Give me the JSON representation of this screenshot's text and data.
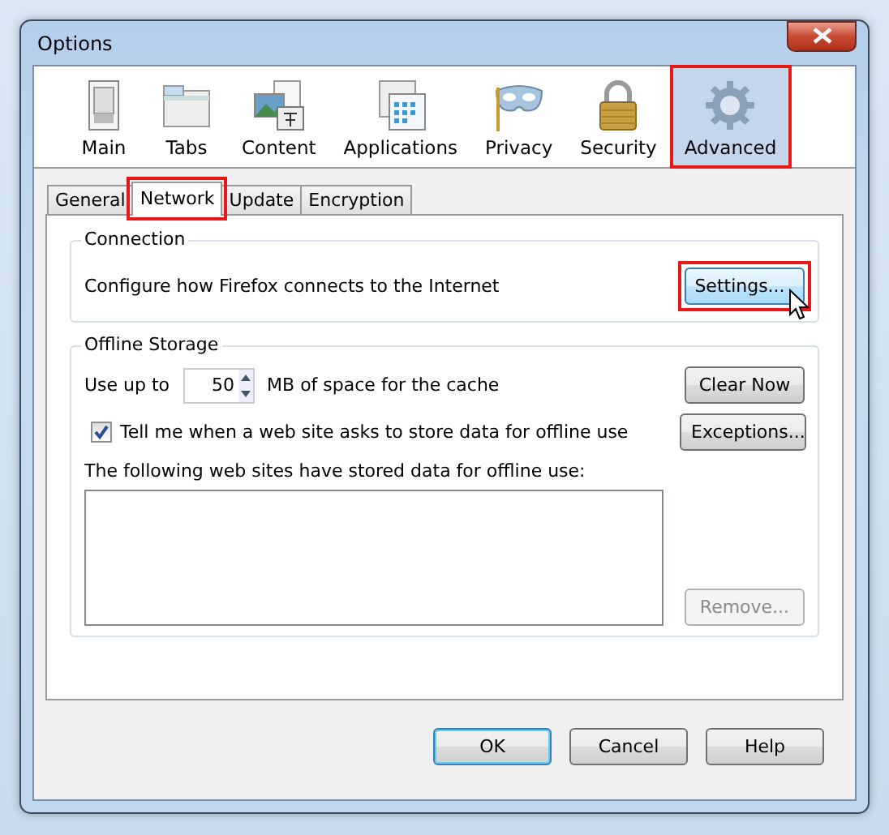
{
  "window": {
    "title": "Options"
  },
  "panes": [
    {
      "label": "Main",
      "selected": false,
      "highlighted": false
    },
    {
      "label": "Tabs",
      "selected": false,
      "highlighted": false
    },
    {
      "label": "Content",
      "selected": false,
      "highlighted": false
    },
    {
      "label": "Applications",
      "selected": false,
      "highlighted": false
    },
    {
      "label": "Privacy",
      "selected": false,
      "highlighted": false
    },
    {
      "label": "Security",
      "selected": false,
      "highlighted": false
    },
    {
      "label": "Advanced",
      "selected": true,
      "highlighted": true
    }
  ],
  "tabs": [
    {
      "label": "General",
      "selected": false,
      "highlighted": false
    },
    {
      "label": "Network",
      "selected": true,
      "highlighted": true
    },
    {
      "label": "Update",
      "selected": false,
      "highlighted": false
    },
    {
      "label": "Encryption",
      "selected": false,
      "highlighted": false
    }
  ],
  "connection": {
    "legend": "Connection",
    "description": "Configure how Firefox connects to the Internet",
    "settings_button": {
      "label": "Settings...",
      "hovered": true,
      "highlighted": true
    }
  },
  "offline_storage": {
    "legend": "Offline Storage",
    "cache_prefix": "Use up to",
    "cache_value": "50",
    "cache_suffix": "MB of space for the cache",
    "clear_button": {
      "label": "Clear Now",
      "disabled": false
    },
    "notify_checkbox": {
      "label": "Tell me when a web site asks to store data for offline use",
      "checked": true
    },
    "exceptions_button": {
      "label": "Exceptions...",
      "disabled": false
    },
    "list_label": "The following web sites have stored data for offline use:",
    "remove_button": {
      "label": "Remove...",
      "disabled": true
    }
  },
  "buttons": [
    {
      "label": "OK",
      "default": true
    },
    {
      "label": "Cancel",
      "default": false
    },
    {
      "label": "Help",
      "default": false
    }
  ]
}
